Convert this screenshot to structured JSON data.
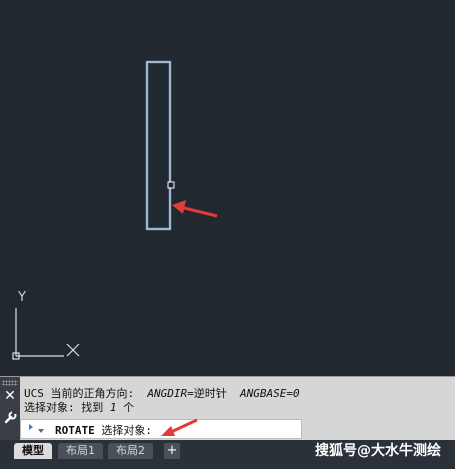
{
  "ucs": {
    "y_label": "Y"
  },
  "command_history": {
    "line1_prefix": "UCS 当前的正角方向:  ",
    "line1_angdir_key": "ANGDIR=",
    "line1_angdir_val": "逆时针  ",
    "line1_angbase": "ANGBASE=0",
    "line2_prefix": "选择对象: 找到 ",
    "line2_count": "1",
    "line2_suffix": " 个"
  },
  "command_input": {
    "command": "ROTATE",
    "prompt": " 选择对象:"
  },
  "tabs": [
    {
      "label": "模型",
      "active": true
    },
    {
      "label": "布局1",
      "active": false
    },
    {
      "label": "布局2",
      "active": false
    }
  ],
  "tab_add_label": "+",
  "watermark": "搜狐号@大水牛测绘",
  "colors": {
    "canvas": "#212830",
    "selected_outline": "#d8ecff",
    "arrow": "#e23b3b",
    "ucs_icon": "#e0e0e0"
  }
}
